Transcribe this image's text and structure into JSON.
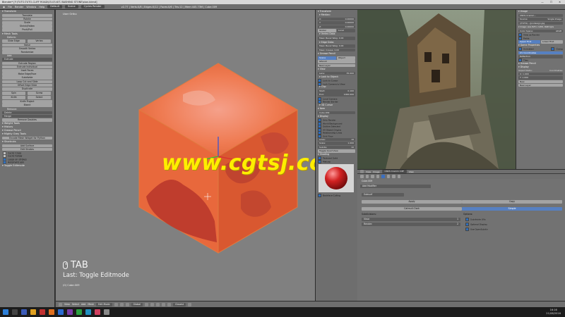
{
  "window": {
    "title": "Blender* [F:\\TUTO-TUTO-CLIFF ROAD\\03-03-KIT- BASHING STONE\\ston.blend]"
  },
  "topbar": {
    "menus": [
      "File",
      "Render",
      "Window",
      "Help"
    ],
    "layout": "Default",
    "scene": "Scene",
    "engine": "Cycles Render",
    "stats": "v2.77 | Verts:0/8 | Edges:0/12 | Faces:0/6 | Tris:12 | Mem:445.73M | Cube.009"
  },
  "toolshelf": {
    "transform_header": "Transform",
    "transform_buttons": [
      "Translate",
      "Rotate",
      "Scale",
      "Shrink/Fatten",
      "Push/Pull"
    ],
    "mesh_tools_header": "Mesh Tools",
    "deform_label": "Deform:",
    "deform_row1": [
      "Slide Edge",
      "Vertex"
    ],
    "deform_buttons": [
      "Noise",
      "Smooth Vertex",
      "Randomize"
    ],
    "add_label": "Add:",
    "extrude_dropdown": "Extrude",
    "add_buttons": [
      "Extrude Region",
      "Extrude Individual",
      "Inset Faces",
      "Make Edge/Face",
      "Subdivide",
      "Loop Cut and Slide",
      "Offset Edge Slide",
      "Duplicate"
    ],
    "spin_row": [
      "Spin",
      "Screw"
    ],
    "knife_row": [
      "Knife",
      "Select"
    ],
    "add_buttons2": [
      "Knife Project",
      "Bisect"
    ],
    "remove_label": "Remove:",
    "delete_dropdown": "Delete",
    "merge_dropdown": "Merge",
    "remove_doubles": "Remove Doubles",
    "collapsed_panels": [
      "Weight Tools",
      "History",
      "Grease Pencil",
      "Mighty Grey Tools"
    ],
    "python_btn": "Encode Mesh Widget for Python",
    "shortcuts_header": "Shortcuts",
    "shortcut_buttons": [
      "Add Surface",
      "Edit Strokes"
    ],
    "checkboxes": [
      "Cyclic Cross",
      "Cyclic Follow",
      "Loops on strokes",
      "Automatic join"
    ],
    "toggle_label": "Toggle Editmode"
  },
  "viewport": {
    "view_label": "User Ortho",
    "object_label": "(0) Cube.009",
    "key_pressed": "TAB",
    "last_operator": "Last: Toggle Editmode",
    "watermark": "www.cgtsj.com"
  },
  "npanel": {
    "transform_header": "Transform",
    "median_label": "Median:",
    "xyz": [
      {
        "k": "X:",
        "v": "0.00000"
      },
      {
        "k": "Y:",
        "v": "0.00000"
      },
      {
        "k": "Z:",
        "v": "0.00000"
      }
    ],
    "coord_tabs": [
      "Global",
      "Local"
    ],
    "vertex_data_label": "Vertex Data:",
    "mean_bevel": "Mean Bevel Weig: 0.00",
    "edge_data_label": "Edge Data:",
    "edge_rows": [
      "Mean Bevel Weig: 0.00",
      "Mean Crease: 0.00"
    ],
    "grease_header": "Grease Pencil",
    "scene_object": [
      "Scene",
      "Object"
    ],
    "gp_layer": "GPencil",
    "new_layer": "New Layer",
    "view_header": "View",
    "lens": {
      "k": "Lens:",
      "v": "35.000"
    },
    "lock_label": "Lock to Object:",
    "lock_rows": [
      "Lock to Cursor",
      "Lock Camera to View"
    ],
    "clip_label": "Clip:",
    "clip_rows": [
      {
        "k": "Start:",
        "v": "0.100"
      },
      {
        "k": "End:",
        "v": "1000.000"
      }
    ],
    "local_camera": "Local Camera",
    "render_border": "Render Border",
    "cursor_label": "3D Cursor",
    "item_header": "Item",
    "item_name": "Cube.009",
    "display_header": "Display",
    "display_checks": [
      "Only Render",
      "World Background",
      "Outline Selected",
      "All Object Origins",
      "Relationship Lines",
      "Grid Floor"
    ],
    "lines": {
      "k": "Lines:",
      "v": "16"
    },
    "scale": {
      "k": "Scale:",
      "v": "1.000"
    },
    "subdiv": {
      "k": "Subdiv:",
      "v": "10"
    },
    "quad_view": "Toggle Quad View",
    "shading_header": "Shading",
    "shading_checks": [
      "Textured Solid",
      "Matcap"
    ],
    "backface": "Backface Culling"
  },
  "image_editor": {
    "side_header": "Image",
    "image_name": "CNCS Cramm...",
    "source_label": "Source:",
    "source_value": "Single Image",
    "filepath": "//TUTO/.../Jondesign.jpg",
    "image_info": "Image: size 825 x 1209, RGB byte",
    "color_space_label": "Color Space:",
    "color_space": "sRGB",
    "view_as_render": "View as Render",
    "fields": "Fields",
    "alpha_row": [
      "Upper First",
      "Lower First"
    ],
    "game_header": "Game Properties",
    "animated": "Animated",
    "clamp": "Clamp",
    "uv_coords": "UV Coordinates",
    "reflection": "Reflection",
    "tiles": "Tiles",
    "grease_header": "Grease Pencil",
    "display_header": "Display",
    "aspect_label": "Aspect Ratio:",
    "coords_label": "Coordinates:",
    "aspect_x": "X: 1.000",
    "aspect_y": "Y: 1.000",
    "new_btn": "New",
    "new_layer": "New Layer",
    "header_items": [
      "View",
      "Image",
      "CNCS Cramm Cliff",
      "View"
    ]
  },
  "modifiers": {
    "object_name": "Cube.009",
    "add_modifier": "Add Modifier",
    "modifier_name": "Subsurf",
    "apply": "Apply",
    "copy": "Copy",
    "algorithms": [
      "Catmull-Clark",
      "Simple"
    ],
    "subdivisions_label": "Subdivisions:",
    "view": {
      "k": "View:",
      "v": "1"
    },
    "render": {
      "k": "Render:",
      "v": "2"
    },
    "options_label": "Options:",
    "options": [
      "Subdivide UVs",
      "Optimal Display",
      "Use OpenSubdiv"
    ]
  },
  "vp_header": {
    "items": [
      "View",
      "Select",
      "Add",
      "Mesh"
    ],
    "mode": "Edit Mode",
    "pivot": "Global",
    "snap": "Closest"
  },
  "taskbar": {
    "time": "16:16",
    "date": "21/08/2016"
  },
  "colors": {
    "cube_front": "#e86a3e",
    "cube_side": "#d9582f",
    "cube_top": "#f07a50",
    "watermark": "#ffee00",
    "accent_blue": "#5680c2"
  }
}
